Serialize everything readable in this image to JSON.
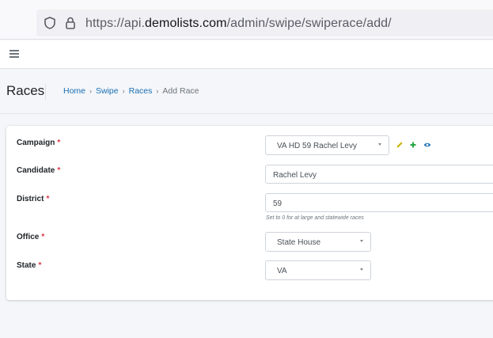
{
  "browser": {
    "url_prefix": "https://api.",
    "url_domain": "demolists.com",
    "url_path": "/admin/swipe/swiperace/add/",
    "icons": [
      "shield-icon",
      "lock-icon"
    ]
  },
  "header": {
    "menu_icon": "hamburger-menu-icon"
  },
  "page": {
    "title": "Races",
    "breadcrumb": [
      {
        "label": "Home"
      },
      {
        "label": "Swipe"
      },
      {
        "label": "Races"
      },
      {
        "label": "Add Race"
      }
    ],
    "breadcrumb_separator": "›"
  },
  "form": {
    "required_marker": "*",
    "campaign": {
      "label": "Campaign",
      "value": "VA HD 59 Rachel Levy",
      "actions": [
        "pencil-icon",
        "plus-icon",
        "eye-icon"
      ]
    },
    "candidate": {
      "label": "Candidate",
      "value": "Rachel Levy"
    },
    "district": {
      "label": "District",
      "value": "59",
      "help": "Set to 0 for at large and statewide races"
    },
    "office": {
      "label": "Office",
      "value": "State House"
    },
    "state": {
      "label": "State",
      "value": "VA"
    }
  },
  "colors": {
    "link": "#1a6fb5",
    "required": "#dc3545",
    "edit_icon": "#c9b400",
    "add_icon": "#28a745",
    "view_icon": "#1a6fb5"
  }
}
